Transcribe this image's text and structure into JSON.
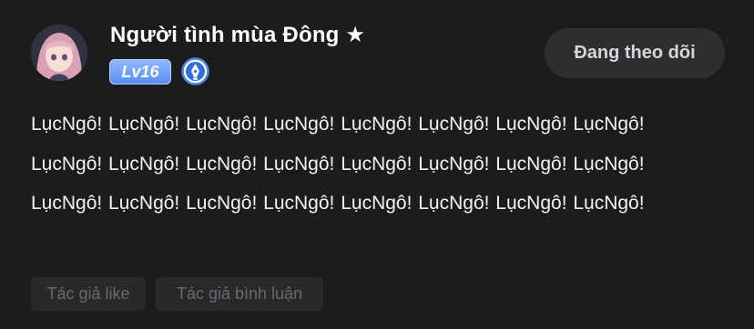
{
  "user": {
    "name": "Người tình mùa Đông ★",
    "level": "Lv16",
    "avatar_icon": "anime-girl-avatar",
    "creator_icon": "pen-nib-badge-icon"
  },
  "follow_button": {
    "label": "Đang theo dõi"
  },
  "comment": {
    "text": "LụcNgô! LụcNgô! LụcNgô! LụcNgô! LụcNgô! LụcNgô! LụcNgô! LụcNgô! LụcNgô! LụcNgô! LụcNgô! LụcNgô! LụcNgô! LụcNgô! LụcNgô! LụcNgô! LụcNgô! LụcNgô! LụcNgô! LụcNgô! LụcNgô! LụcNgô! LụcNgô! LụcNgô!"
  },
  "tags": [
    {
      "label": "Tác giả like"
    },
    {
      "label": "Tác giả bình luận"
    }
  ],
  "colors": {
    "background": "#1c1c1e",
    "level_badge": "#6d9cf5",
    "button_bg": "#2e2e31",
    "tag_text": "#6a6a6e"
  }
}
